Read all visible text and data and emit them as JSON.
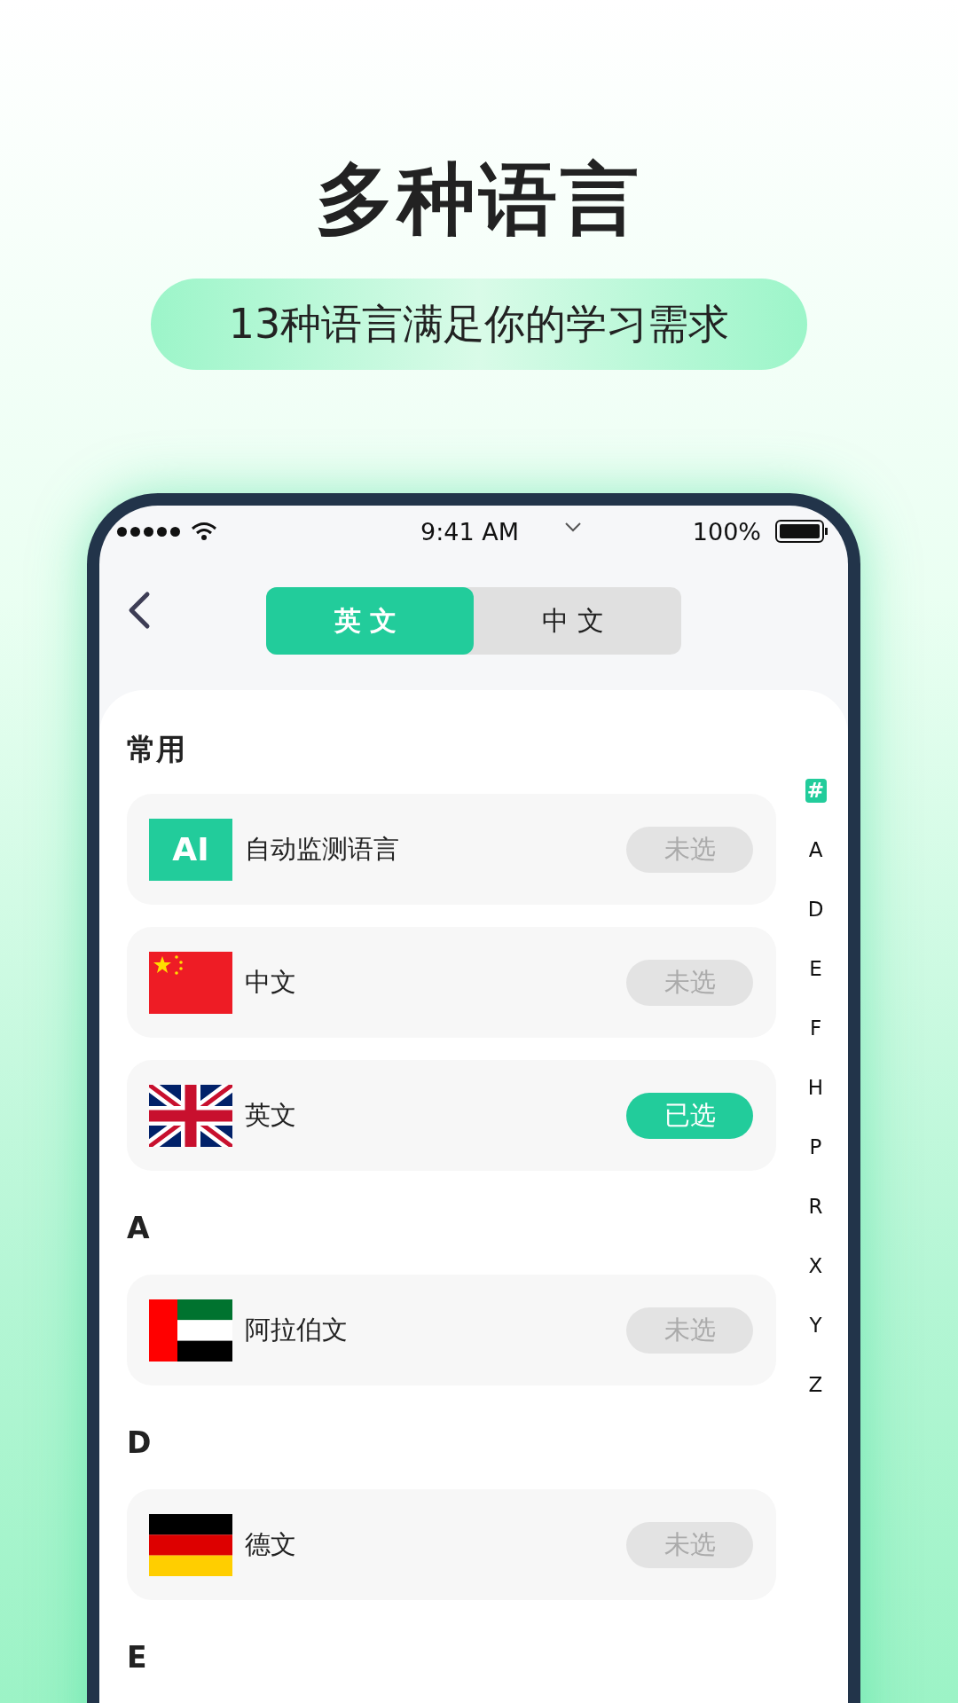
{
  "headline": "多种语言",
  "subtitle": "13种语言满足你的学习需求",
  "status_bar": {
    "time": "9:41 AM",
    "battery": "100%"
  },
  "tabs": [
    {
      "label": "英文",
      "selected": true
    },
    {
      "label": "中文",
      "selected": false
    }
  ],
  "sections": [
    {
      "title": "常用",
      "items": [
        {
          "kind": "ai",
          "badge": "AI",
          "name": "自动监测语言",
          "status": "未选",
          "selected": false
        },
        {
          "kind": "china",
          "name": "中文",
          "status": "未选",
          "selected": false
        },
        {
          "kind": "uk",
          "name": "英文",
          "status": "已选",
          "selected": true
        }
      ]
    },
    {
      "title": "A",
      "items": [
        {
          "kind": "uae",
          "name": "阿拉伯文",
          "status": "未选",
          "selected": false
        }
      ]
    },
    {
      "title": "D",
      "items": [
        {
          "kind": "germany",
          "name": "德文",
          "status": "未选",
          "selected": false
        }
      ]
    },
    {
      "title": "E"
    }
  ],
  "index": [
    {
      "label": "#",
      "selected": true
    },
    {
      "label": "A",
      "selected": false
    },
    {
      "label": "D",
      "selected": false
    },
    {
      "label": "E",
      "selected": false
    },
    {
      "label": "F",
      "selected": false
    },
    {
      "label": "H",
      "selected": false
    },
    {
      "label": "P",
      "selected": false
    },
    {
      "label": "R",
      "selected": false
    },
    {
      "label": "X",
      "selected": false
    },
    {
      "label": "Y",
      "selected": false
    },
    {
      "label": "Z",
      "selected": false
    }
  ]
}
